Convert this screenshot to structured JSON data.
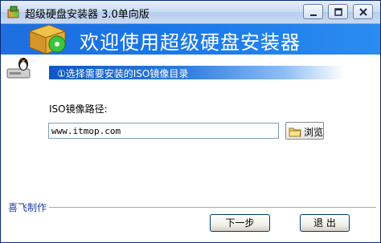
{
  "window": {
    "title": "超级硬盘安装器 3.0单向版"
  },
  "banner": {
    "heading": "欢迎使用超级硬盘安装器"
  },
  "step": {
    "text": "①选择需要安装的ISO镜像目录"
  },
  "form": {
    "path_label": "ISO镜像路径:",
    "path_value": "www.itmop.com",
    "browse_label": "浏览"
  },
  "footer": {
    "credit": "喜飞制作",
    "next_label": "下一步",
    "exit_label": "退 出"
  },
  "colors": {
    "banner": "#1976e8",
    "credit": "#1a3fa8"
  },
  "icons": [
    "app-icon",
    "software-box-icon",
    "penguin-icon",
    "folder-icon",
    "minimize-icon",
    "maximize-icon",
    "close-icon"
  ]
}
